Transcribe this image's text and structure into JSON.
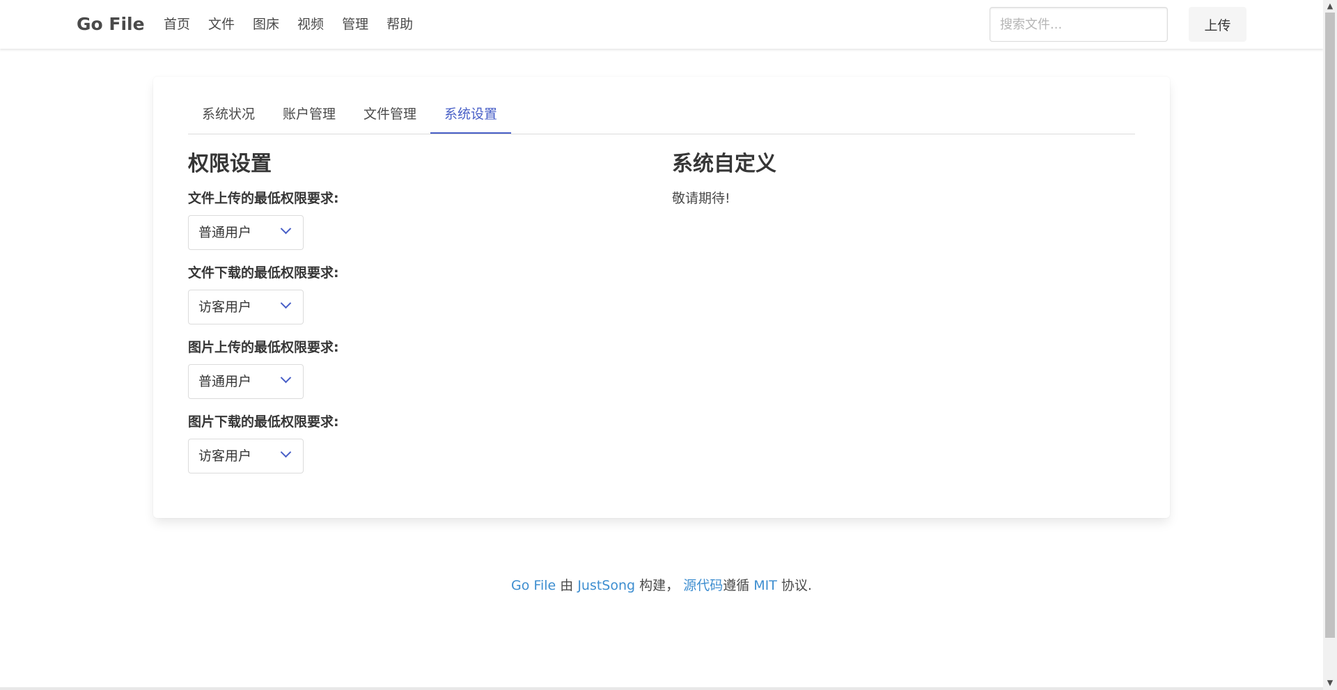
{
  "navbar": {
    "brand": "Go File",
    "items": [
      "首页",
      "文件",
      "图床",
      "视频",
      "管理",
      "帮助"
    ],
    "search_placeholder": "搜索文件...",
    "upload_label": "上传"
  },
  "tabs": {
    "items": [
      "系统状况",
      "账户管理",
      "文件管理",
      "系统设置"
    ],
    "active": "系统设置"
  },
  "permissions": {
    "title": "权限设置",
    "fields": [
      {
        "label": "文件上传的最低权限要求:",
        "value": "普通用户"
      },
      {
        "label": "文件下载的最低权限要求:",
        "value": "访客用户"
      },
      {
        "label": "图片上传的最低权限要求:",
        "value": "普通用户"
      },
      {
        "label": "图片下载的最低权限要求:",
        "value": "访客用户"
      }
    ]
  },
  "custom": {
    "title": "系统自定义",
    "text": "敬请期待!"
  },
  "footer": {
    "app_link": "Go File",
    "by": " 由 ",
    "author_link": "JustSong",
    "built": " 构建， ",
    "source_link": "源代码",
    "follows": "遵循 ",
    "license_link": "MIT",
    "suffix": " 协议."
  },
  "colors": {
    "accent": "#485fc7",
    "link": "#3e8ed0"
  }
}
